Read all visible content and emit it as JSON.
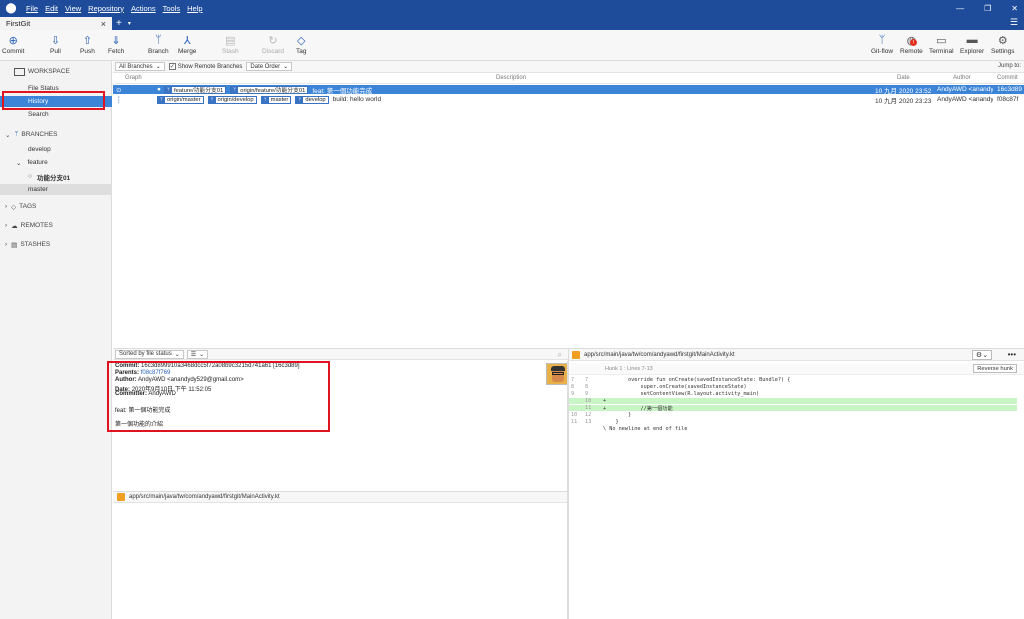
{
  "titlebar": {
    "menus": [
      "File",
      "Edit",
      "View",
      "Repository",
      "Actions",
      "Tools",
      "Help"
    ],
    "controls": [
      "—",
      "❐",
      "✕"
    ]
  },
  "tabs": [
    {
      "label": "FirstGit",
      "close": "×"
    }
  ],
  "tabbar": {
    "plus": "+",
    "caret": "▾",
    "hamburger": "☰"
  },
  "toolbar": {
    "left": [
      {
        "label": "Commit",
        "icon": "⊕"
      },
      {
        "label": "Pull",
        "icon": "⇩"
      },
      {
        "label": "Push",
        "icon": "⇧"
      },
      {
        "label": "Fetch",
        "icon": "⇓"
      },
      {
        "label": "Branch",
        "icon": "ᛘ"
      },
      {
        "label": "Merge",
        "icon": "⅄"
      },
      {
        "label": "Stash",
        "icon": "▤"
      },
      {
        "label": "Discard",
        "icon": "↻"
      },
      {
        "label": "Tag",
        "icon": "◇"
      }
    ],
    "right": [
      {
        "label": "Git-flow",
        "icon": "ᛘ"
      },
      {
        "label": "Remote",
        "icon": "◍",
        "badge": "!"
      },
      {
        "label": "Terminal",
        "icon": "▭"
      },
      {
        "label": "Explorer",
        "icon": "▬"
      },
      {
        "label": "Settings",
        "icon": "⚙"
      }
    ]
  },
  "sidebar": {
    "workspace": "WORKSPACE",
    "workspace_items": [
      "File Status",
      "History",
      "Search"
    ],
    "branches": "BRANCHES",
    "branch_develop": "develop",
    "branch_feature": "feature",
    "branch_feature_sub": "功能分支01",
    "branch_master": "master",
    "tags": "TAGS",
    "remotes": "REMOTES",
    "stashes": "STASHES"
  },
  "filterbar": {
    "branches_dd": "All Branches",
    "show_remote": "Show Remote Branches",
    "order_dd": "Date Order",
    "jump": "Jump to:"
  },
  "columns": {
    "graph": "Graph",
    "description": "Description",
    "date": "Date",
    "author": "Author",
    "commit": "Commit"
  },
  "commits": [
    {
      "labels": [
        "feature/功能分支01",
        "origin/feature/功能分支01"
      ],
      "message": "feat: 第一個功能完成",
      "date": "10 九月 2020 23:52",
      "author": "AndyAWD <anandydy529@gmail.com>",
      "hash": "16c3d89"
    },
    {
      "labels": [
        "origin/master",
        "origin/develop",
        "master",
        "develop"
      ],
      "message": "build: hello world",
      "date": "10 九月 2020 23:23",
      "author": "AndyAWD <anandydy529@gmail.com>",
      "hash": "f08c87f"
    }
  ],
  "details_bar": {
    "sort": "Sorted by file status",
    "view": "☰"
  },
  "details": {
    "commit_label": "Commit:",
    "commit_value": "16c3d899910a3468dcc5f72a08b9c3215d741a61 [16c3d89]",
    "parents_label": "Parents:",
    "parents_value": "f08c87f769",
    "author_label": "Author:",
    "author_value": "AndyAWD <anandydy529@gmail.com>",
    "date_label": "Date:",
    "date_value": "2020年9月10日 下午 11:52:05",
    "committer_label": "Committer:",
    "committer_value": "AndyAWD",
    "message": "feat: 第一個功能完成",
    "body": "第一個功能的介紹"
  },
  "file_path": "app/src/main/java/tw/com/andyawd/firstgit/MainActivity.kt",
  "diff": {
    "hunk": "Hunk 1 : Lines 7-13",
    "reverse": "Reverse hunk",
    "lines": [
      {
        "o": "7",
        "n": "7",
        "type": "ctx",
        "code": "        override fun onCreate(savedInstanceState: Bundle?) {"
      },
      {
        "o": "8",
        "n": "8",
        "type": "ctx",
        "code": "            super.onCreate(savedInstanceState)"
      },
      {
        "o": "9",
        "n": "9",
        "type": "ctx",
        "code": "            setContentView(R.layout.activity_main)"
      },
      {
        "o": "",
        "n": "10",
        "type": "add",
        "code": "+"
      },
      {
        "o": "",
        "n": "11",
        "type": "add",
        "code": "+           //第一個功能"
      },
      {
        "o": "10",
        "n": "12",
        "type": "ctx",
        "code": "        }"
      },
      {
        "o": "11",
        "n": "13",
        "type": "ctx",
        "code": "    }"
      },
      {
        "o": "",
        "n": "",
        "type": "ctx",
        "code": "\\ No newline at end of file"
      }
    ]
  },
  "colors": {
    "titlebar": "#1e4c9a",
    "selection": "#3b84d8",
    "highlight": "#e0141e",
    "added": "#c9f5c6"
  }
}
